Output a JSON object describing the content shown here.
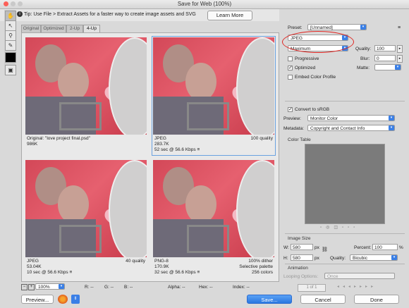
{
  "window": {
    "title": "Save for Web (100%)"
  },
  "tipbar": {
    "tip": "Tip: Use File > Extract Assets for a faster way to create image assets and SVG",
    "learn_more": "Learn More"
  },
  "tools": [
    "hand-icon",
    "slice-select-icon",
    "zoom-icon",
    "eyedropper-icon",
    "color-swatch",
    "toggle-slices-icon"
  ],
  "tabs": [
    "Original",
    "Optimized",
    "2-Up",
    "4-Up"
  ],
  "cells": [
    {
      "left_lines": [
        "Original: \"love project final.psd\"",
        "986K"
      ],
      "right_lines": []
    },
    {
      "left_lines": [
        "JPEG",
        "283.7K",
        "52 sec @ 56.6 Kbps"
      ],
      "right_lines": [
        "100 quality"
      ],
      "menu_icon": "≡"
    },
    {
      "left_lines": [
        "JPEG",
        "53.04K",
        "10 sec @ 56.6 Kbps"
      ],
      "right_lines": [
        "40 quality"
      ],
      "menu_icon": "≡"
    },
    {
      "left_lines": [
        "PNG-8",
        "170.9K",
        "32 sec @ 56.6 Kbps"
      ],
      "right_lines": [
        "100% dither",
        "Selective palette",
        "256 colors"
      ],
      "menu_icon": "≡"
    }
  ],
  "settings": {
    "preset_label": "Preset:",
    "preset_value": "[Unnamed]",
    "format_value": "JPEG",
    "compression_value": "Maximum",
    "quality_label": "Quality:",
    "quality_value": "100",
    "blur_label": "Blur:",
    "blur_value": "0",
    "matte_label": "Matte:",
    "progressive_label": "Progressive",
    "progressive_checked": false,
    "optimized_label": "Optimized",
    "optimized_checked": true,
    "embed_label": "Embed Color Profile",
    "embed_checked": false,
    "srgb_label": "Convert to sRGB",
    "srgb_checked": true,
    "preview_label": "Preview:",
    "preview_value": "Monitor Color",
    "metadata_label": "Metadata:",
    "metadata_value": "Copyright and Contact Info",
    "color_table_label": "Color Table",
    "annotation_color": "#e0231f",
    "accent_color": "#3a7fe6"
  },
  "image_size": {
    "section_label": "Image Size",
    "w_label": "W:",
    "w_value": "580",
    "h_label": "H:",
    "h_value": "580",
    "unit": "px",
    "percent_label": "Percent:",
    "percent_value": "100",
    "percent_unit": "%",
    "quality_label": "Quality:",
    "quality_value": "Bicubic"
  },
  "animation": {
    "section_label": "Animation",
    "looping_label": "Looping Options:",
    "looping_value": "Once",
    "frame_counter": "1 of 1"
  },
  "statusbar": {
    "zoom": "100%",
    "r": "R: --",
    "g": "G: --",
    "b": "B: --",
    "alpha": "Alpha: --",
    "hex": "Hex: --",
    "index": "Index: --"
  },
  "buttons": {
    "preview": "Preview...",
    "save": "Save...",
    "cancel": "Cancel",
    "done": "Done"
  }
}
